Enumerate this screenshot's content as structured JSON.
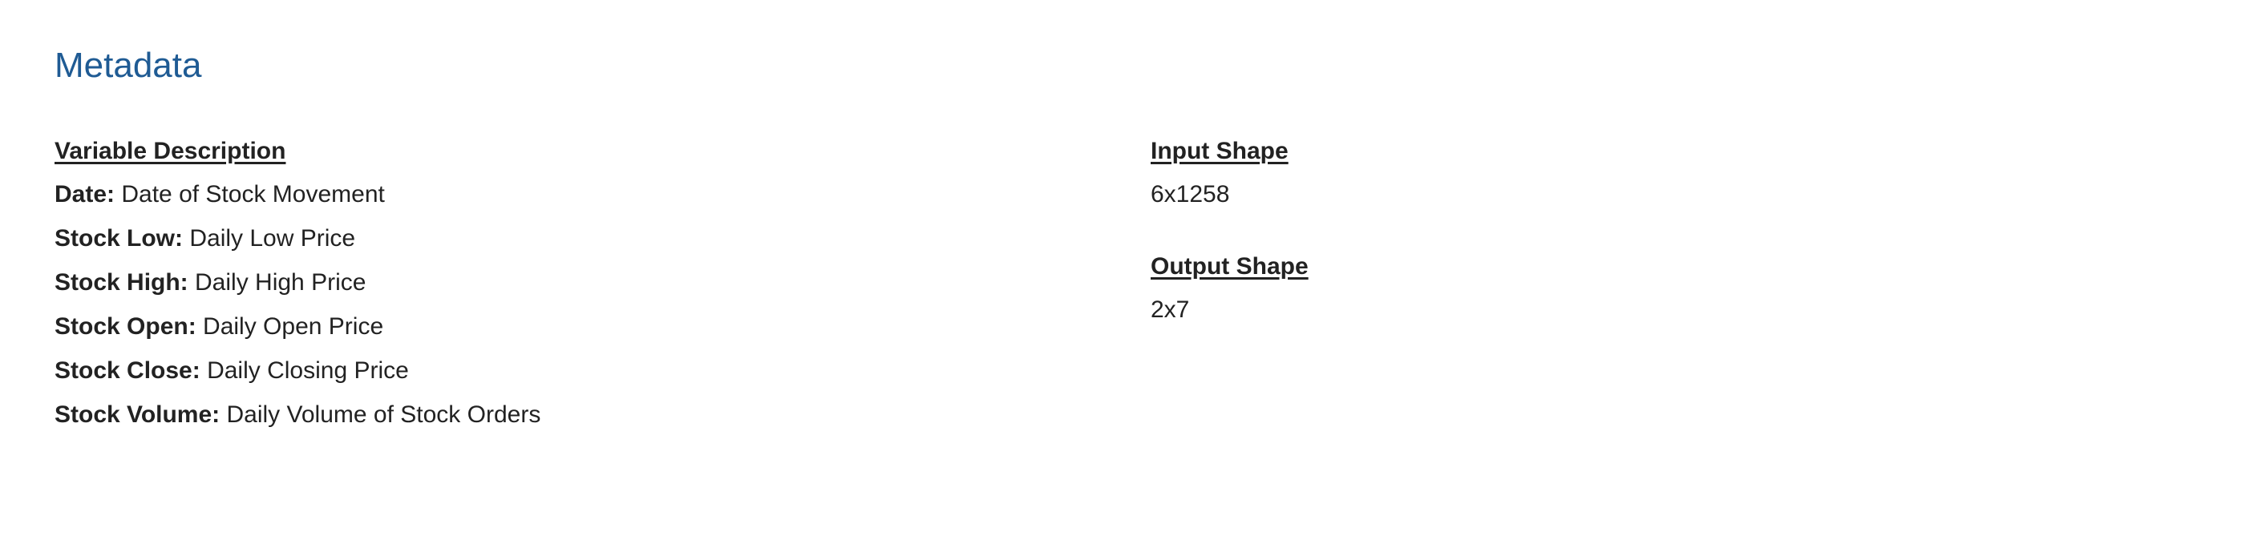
{
  "title": "Metadata",
  "variables": {
    "heading": "Variable Description",
    "items": [
      {
        "name": "Date:",
        "description": "Date of Stock Movement"
      },
      {
        "name": "Stock Low:",
        "description": "Daily Low Price"
      },
      {
        "name": "Stock High:",
        "description": "Daily High Price"
      },
      {
        "name": "Stock Open:",
        "description": "Daily Open Price"
      },
      {
        "name": "Stock Close:",
        "description": "Daily Closing Price"
      },
      {
        "name": "Stock Volume:",
        "description": "Daily Volume of Stock Orders"
      }
    ]
  },
  "input_shape": {
    "heading": "Input Shape",
    "value": "6x1258"
  },
  "output_shape": {
    "heading": "Output Shape",
    "value": "2x7"
  },
  "colors": {
    "title": "#1f5b94",
    "text": "#222222",
    "background": "#ffffff"
  }
}
